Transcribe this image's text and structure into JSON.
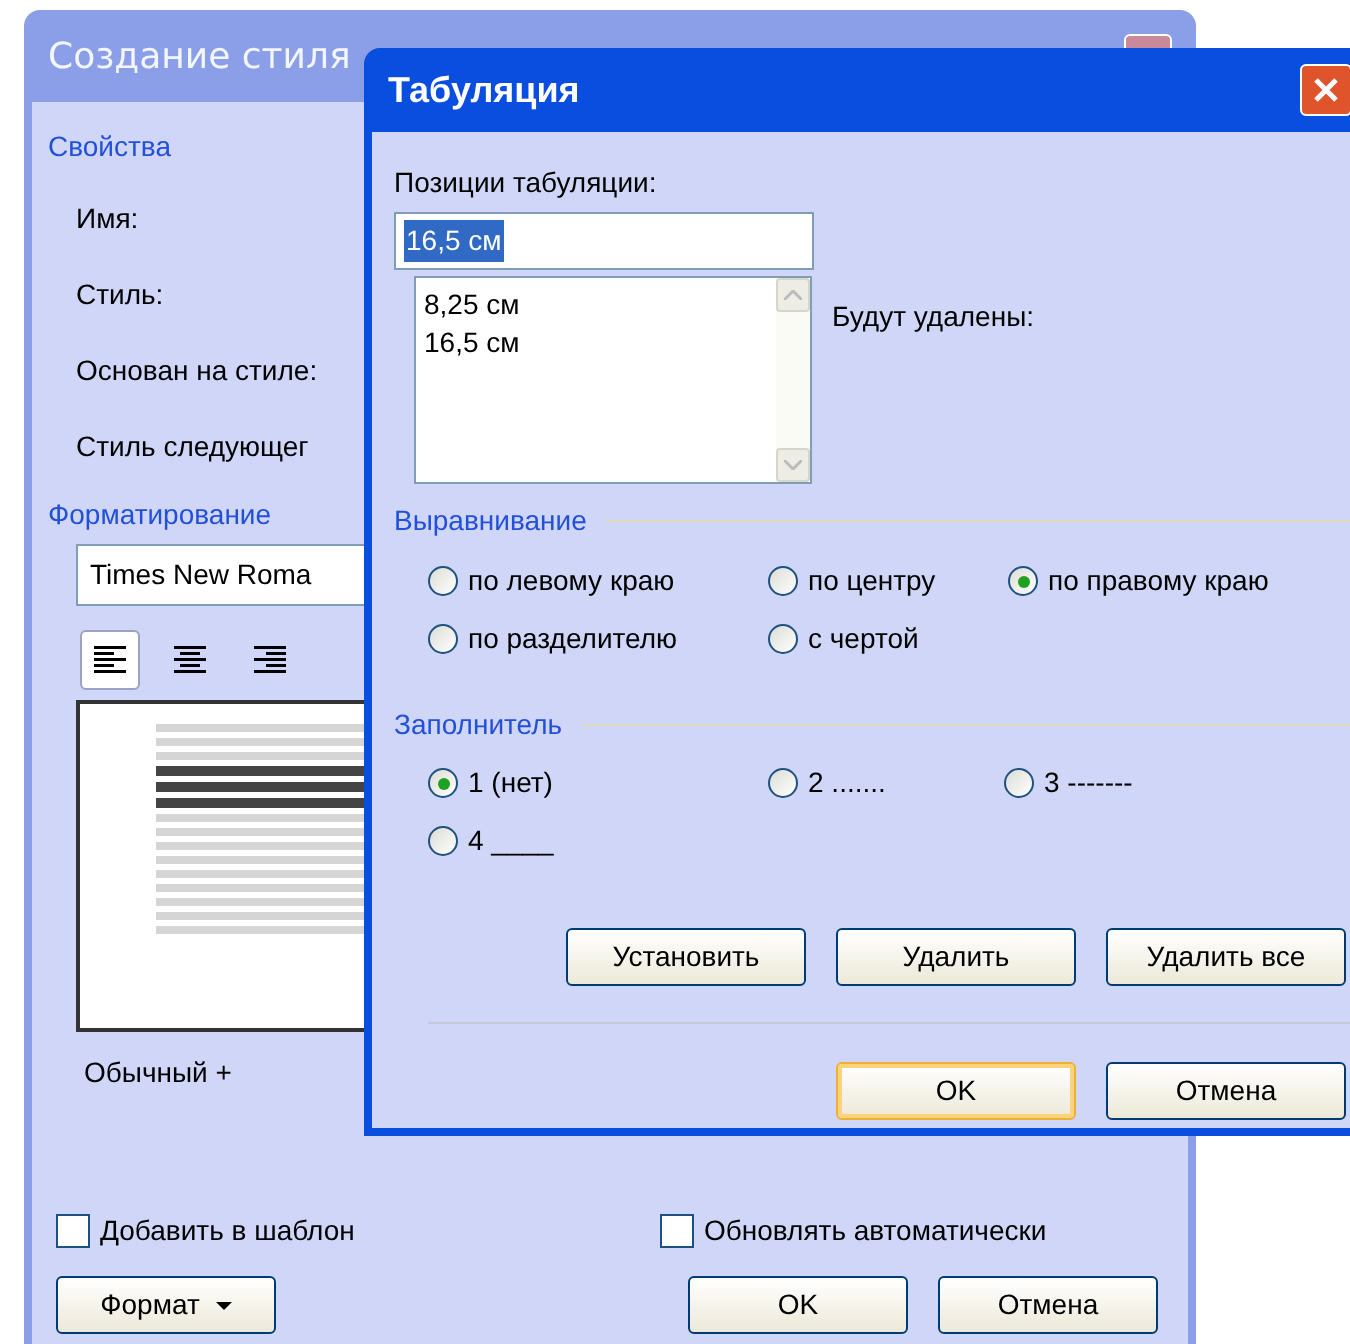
{
  "style_dialog": {
    "title": "Создание стиля",
    "properties": {
      "heading": "Свойства",
      "labels": [
        "Имя:",
        "Стиль:",
        "Основан на стиле:",
        "Стиль следующег"
      ]
    },
    "formatting": {
      "heading": "Форматирование",
      "font": "Times New Roma",
      "alignment_buttons": [
        {
          "kind": "left",
          "selected": true
        },
        {
          "kind": "center",
          "selected": false
        },
        {
          "kind": "right",
          "selected": false
        }
      ],
      "description": "Обычный +"
    },
    "checkboxes": [
      {
        "label": "Добавить в шаблон",
        "checked": false
      },
      {
        "label": "Обновлять автоматически",
        "checked": false
      }
    ],
    "buttons": [
      {
        "label": "Формат",
        "kind": "menu"
      },
      {
        "label": "OK",
        "kind": "plain"
      },
      {
        "label": "Отмена",
        "kind": "plain"
      }
    ]
  },
  "tabs_dialog": {
    "title": "Табуляция",
    "positions_label": "Позиции табуляции:",
    "position_value": "16,5 см",
    "positions": [
      "8,25 см",
      "16,5 см"
    ],
    "to_delete_label": "Будут удалены:",
    "alignment": {
      "heading": "Выравнивание",
      "options": [
        {
          "label": "по левому краю",
          "selected": false
        },
        {
          "label": "по центру",
          "selected": false
        },
        {
          "label": "по правому краю",
          "selected": true
        },
        {
          "label": "по разделителю",
          "selected": false
        },
        {
          "label": "с чертой",
          "selected": false
        }
      ]
    },
    "leader": {
      "heading": "Заполнитель",
      "options": [
        {
          "label": "1 (нет)",
          "selected": true
        },
        {
          "label": "2 .......",
          "selected": false
        },
        {
          "label": "3 -------",
          "selected": false
        },
        {
          "label": "4 ____",
          "selected": false
        }
      ]
    },
    "actions": [
      "Установить",
      "Удалить",
      "Удалить все"
    ],
    "buttons": [
      {
        "label": "OK",
        "default": true
      },
      {
        "label": "Отмена",
        "default": false
      }
    ]
  }
}
